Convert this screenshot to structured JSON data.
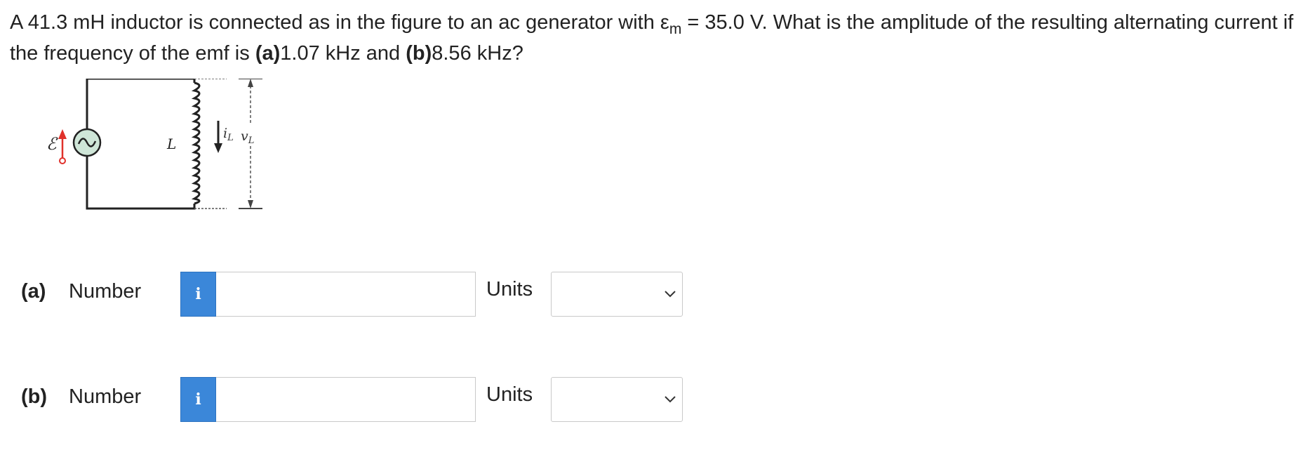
{
  "question": {
    "text_1": "A 41.3 mH inductor is connected as in the figure to an ac generator with ε",
    "emf_subscript": "m",
    "text_2": " = 35.0 V. What is the amplitude of the resulting alternating current if the frequency of the emf is ",
    "part_a_tag": "(a)",
    "part_a_value": "1.07 kHz and ",
    "part_b_tag": "(b)",
    "part_b_value": "8.56 kHz?"
  },
  "figure": {
    "emf_symbol": "ℰ",
    "inductor_label": "L",
    "current_label": "i",
    "current_sub": "L",
    "voltage_label": "v",
    "voltage_sub": "L"
  },
  "answers": [
    {
      "part": "(a)",
      "number_label": "Number",
      "info_icon": "i",
      "value": "",
      "units_label": "Units",
      "units_selected": ""
    },
    {
      "part": "(b)",
      "number_label": "Number",
      "info_icon": "i",
      "value": "",
      "units_label": "Units",
      "units_selected": ""
    }
  ],
  "colors": {
    "info_button": "#3b87d9",
    "emf_arrow": "#e0312b",
    "source_fill": "#cfe6d8"
  }
}
